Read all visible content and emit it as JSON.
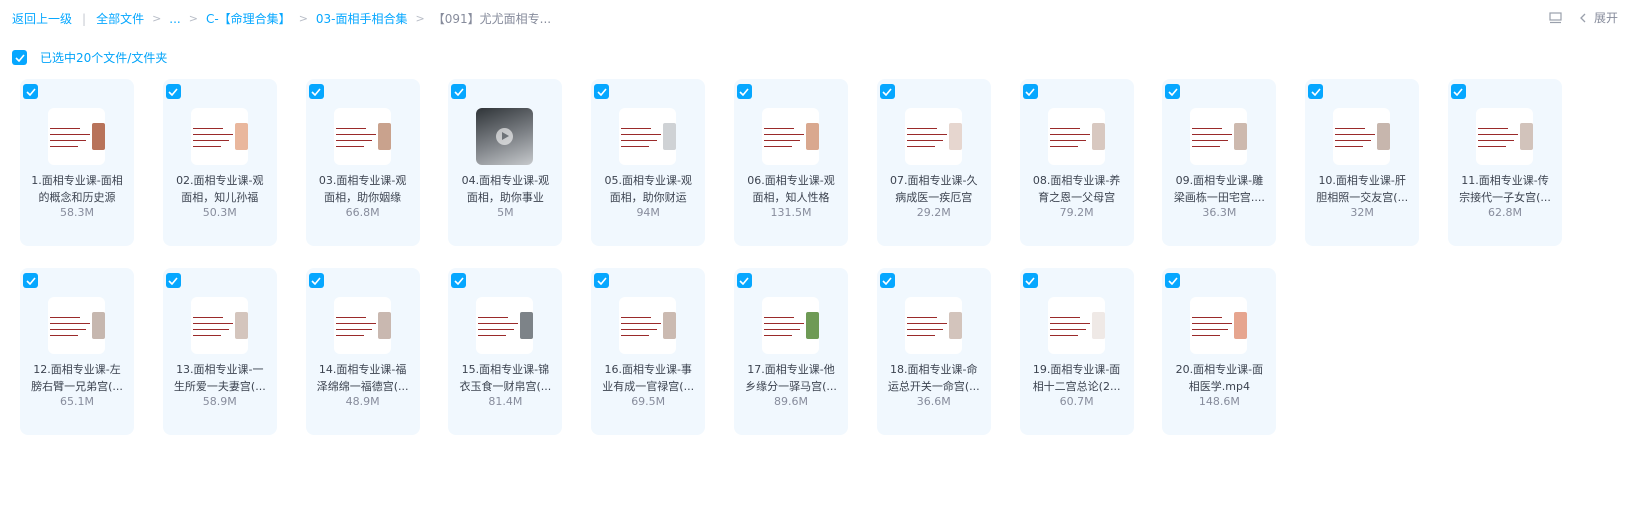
{
  "breadcrumb": {
    "back": "返回上一级",
    "root": "全部文件",
    "ellipsis": "...",
    "level1": "C-【命理合集】",
    "level2": "03-面相手相合集",
    "current": "【091】尤尤面相专..."
  },
  "toolbar": {
    "expand_label": "展开",
    "list_icon": "list-view-icon",
    "chevron_icon": "chevron-left-icon"
  },
  "selection": {
    "label": "已选中20个文件/文件夹",
    "checked": true
  },
  "colors": {
    "accent": "#06a7ff",
    "card_bg": "#f1f8fe",
    "text": "#3c4350",
    "muted": "#878c9c"
  },
  "files": [
    {
      "name": "1.面相专业课-面相的概念和历史源",
      "size": "58.3M",
      "thumb_icon": "document-thumbnail"
    },
    {
      "name": "02.面相专业课-观面相，知儿孙福",
      "size": "50.3M",
      "thumb_icon": "document-thumbnail"
    },
    {
      "name": "03.面相专业课-观面相，助你姻缘",
      "size": "66.8M",
      "thumb_icon": "document-thumbnail"
    },
    {
      "name": "04.面相专业课-观面相，助你事业",
      "size": "5M",
      "thumb_icon": "video-thumbnail"
    },
    {
      "name": "05.面相专业课-观面相，助你财运",
      "size": "94M",
      "thumb_icon": "document-thumbnail"
    },
    {
      "name": "06.面相专业课-观面相，知人性格",
      "size": "131.5M",
      "thumb_icon": "document-thumbnail"
    },
    {
      "name": "07.面相专业课-久病成医一疾厄宫",
      "size": "29.2M",
      "thumb_icon": "document-thumbnail"
    },
    {
      "name": "08.面相专业课-养育之恩一父母宫",
      "size": "79.2M",
      "thumb_icon": "document-thumbnail"
    },
    {
      "name": "09.面相专业课-雕梁画栋一田宅宫....",
      "size": "36.3M",
      "thumb_icon": "document-thumbnail"
    },
    {
      "name": "10.面相专业课-肝胆相照一交友宫(...",
      "size": "32M",
      "thumb_icon": "document-thumbnail"
    },
    {
      "name": "11.面相专业课-传宗接代一子女宫(...",
      "size": "62.8M",
      "thumb_icon": "document-thumbnail"
    },
    {
      "name": "12.面相专业课-左膀右臂一兄弟宫(...",
      "size": "65.1M",
      "thumb_icon": "document-thumbnail"
    },
    {
      "name": "13.面相专业课-一生所爱一夫妻宫(...",
      "size": "58.9M",
      "thumb_icon": "document-thumbnail"
    },
    {
      "name": "14.面相专业课-福泽绵绵一福德宫(...",
      "size": "48.9M",
      "thumb_icon": "document-thumbnail"
    },
    {
      "name": "15.面相专业课-锦衣玉食一财帛宫(...",
      "size": "81.4M",
      "thumb_icon": "document-thumbnail"
    },
    {
      "name": "16.面相专业课-事业有成一官禄宫(...",
      "size": "69.5M",
      "thumb_icon": "document-thumbnail"
    },
    {
      "name": "17.面相专业课-他乡缘分一驿马宫(...",
      "size": "89.6M",
      "thumb_icon": "document-thumbnail"
    },
    {
      "name": "18.面相专业课-命运总开关一命宫(...",
      "size": "36.6M",
      "thumb_icon": "document-thumbnail"
    },
    {
      "name": "19.面相专业课-面相十二宫总论(2...",
      "size": "60.7M",
      "thumb_icon": "document-thumbnail"
    },
    {
      "name": "20.面相专业课-面相医学.mp4",
      "size": "148.6M",
      "thumb_icon": "document-thumbnail"
    }
  ]
}
